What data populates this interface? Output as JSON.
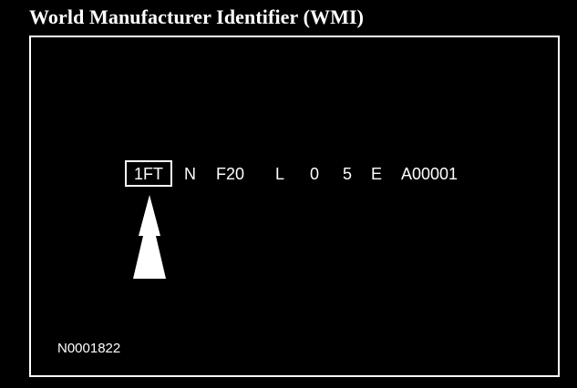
{
  "title": "World Manufacturer Identifier (WMI)",
  "vin": {
    "wmi": "1FT",
    "segments": [
      "N",
      "F20",
      "L",
      "0",
      "5",
      "E",
      "A00001"
    ]
  },
  "highlighted_segment": "wmi",
  "pointer_icon": "up-arrow-icon",
  "reference_code": "N0001822",
  "colors": {
    "background": "#000000",
    "foreground": "#ffffff"
  }
}
